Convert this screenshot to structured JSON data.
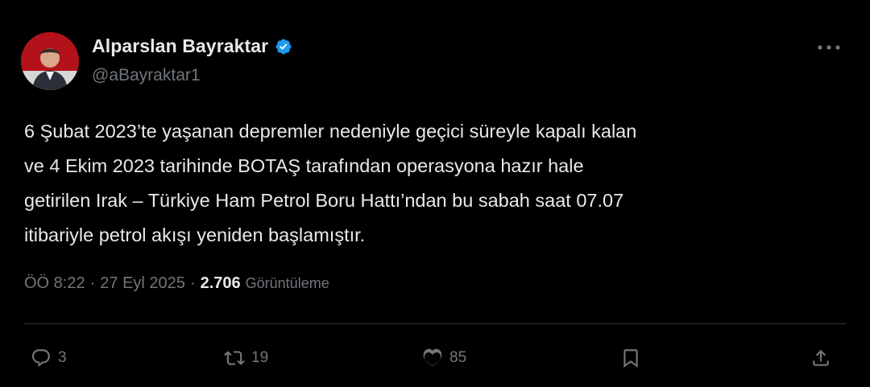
{
  "author": {
    "display_name": "Alparslan Bayraktar",
    "handle": "@aBayraktar1",
    "verified": true
  },
  "tweet": {
    "lines": [
      "6 Şubat 2023’te yaşanan depremler nedeniyle geçici süreyle kapalı kalan",
      "ve 4 Ekim 2023 tarihinde BOTAŞ tarafından operasyona hazır hale",
      "getirilen Irak – Türkiye Ham Petrol Boru Hattı’ndan bu sabah saat 07.07",
      "itibariyle petrol akışı yeniden başlamıştır."
    ]
  },
  "meta": {
    "time": "ÖÖ 8:22",
    "separator": "·",
    "date": "27 Eyl 2025",
    "views_count": "2.706",
    "views_label": "Görüntüleme"
  },
  "actions": {
    "reply_count": "3",
    "retweet_count": "19",
    "like_count": "85"
  },
  "colors": {
    "background": "#000000",
    "text_primary": "#e7e9ea",
    "text_secondary": "#71767b",
    "verified_blue": "#1d9bf0",
    "avatar_red": "#b3121b"
  },
  "icons": {
    "more": "more-dots-icon",
    "reply": "reply-icon",
    "retweet": "retweet-icon",
    "like": "heart-icon",
    "bookmark": "bookmark-icon",
    "share": "share-icon"
  }
}
